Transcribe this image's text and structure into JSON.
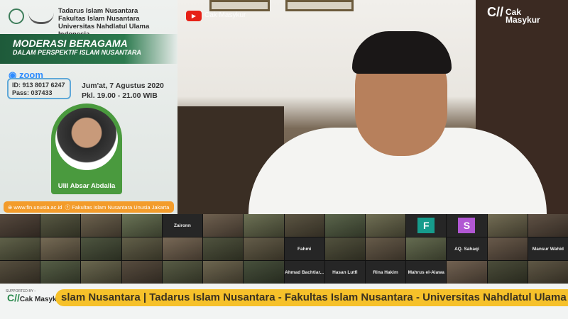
{
  "poster": {
    "org_lines": [
      "Tadarus Islam Nusantara",
      "Fakultas Islam Nusantara",
      "Universitas Nahdlatul Ulama Indonesia"
    ],
    "title": "MODERASI BERAGAMA",
    "subtitle": "DALAM PERSPEKTIF ISLAM NUSANTARA",
    "zoom_label": "zoom",
    "zoom_id": "ID: 913 8017 6247",
    "zoom_pass": "Pass: 037433",
    "date": "Jum'at, 7 Agustus 2020",
    "time": "Pkl. 19.00 - 21.00 WIB",
    "speaker": "Ulil Absar Abdalla",
    "website": "www.fin.unusia.ac.id",
    "facebook": "Fakultas Islam Nusantara Unusia Jakarta"
  },
  "video": {
    "channel": "Cak Masykur",
    "brand": [
      "Cak",
      "Masykur"
    ]
  },
  "grid": {
    "tiles": [
      {
        "t": "video"
      },
      {
        "t": "video"
      },
      {
        "t": "video"
      },
      {
        "t": "video"
      },
      {
        "t": "name",
        "v": "Zaironn"
      },
      {
        "t": "video"
      },
      {
        "t": "video"
      },
      {
        "t": "video"
      },
      {
        "t": "video"
      },
      {
        "t": "video"
      },
      {
        "t": "initial",
        "v": "F",
        "c": "#169c8c"
      },
      {
        "t": "initial",
        "v": "S",
        "c": "#b157d3"
      },
      {
        "t": "video"
      },
      {
        "t": "video"
      },
      {
        "t": "video"
      },
      {
        "t": "video"
      },
      {
        "t": "video"
      },
      {
        "t": "video"
      },
      {
        "t": "video"
      },
      {
        "t": "video"
      },
      {
        "t": "video"
      },
      {
        "t": "name",
        "v": "Fahmi"
      },
      {
        "t": "video"
      },
      {
        "t": "video"
      },
      {
        "t": "video"
      },
      {
        "t": "name",
        "v": "AQ. Sahaqi"
      },
      {
        "t": "video"
      },
      {
        "t": "name",
        "v": "Mansur Wahid"
      },
      {
        "t": "video"
      },
      {
        "t": "video"
      },
      {
        "t": "video"
      },
      {
        "t": "video"
      },
      {
        "t": "video"
      },
      {
        "t": "video"
      },
      {
        "t": "video"
      },
      {
        "t": "name",
        "v": "Ahmad Bachtiar..."
      },
      {
        "t": "name",
        "v": "Hasan Lutfi"
      },
      {
        "t": "name",
        "v": "Rina Hakim"
      },
      {
        "t": "name",
        "v": "Mahrus el-Alawa"
      },
      {
        "t": "video"
      },
      {
        "t": "video"
      },
      {
        "t": "video"
      }
    ]
  },
  "footer": {
    "supported_by": "SUPPORTED BY :",
    "brand": [
      "Cak",
      "Masykur"
    ],
    "ticker": "slam Nusantara | Tadarus Islam Nusantara - Fakultas Islam Nusantara - Universitas Nahdlatul Ulama Indonesia"
  }
}
